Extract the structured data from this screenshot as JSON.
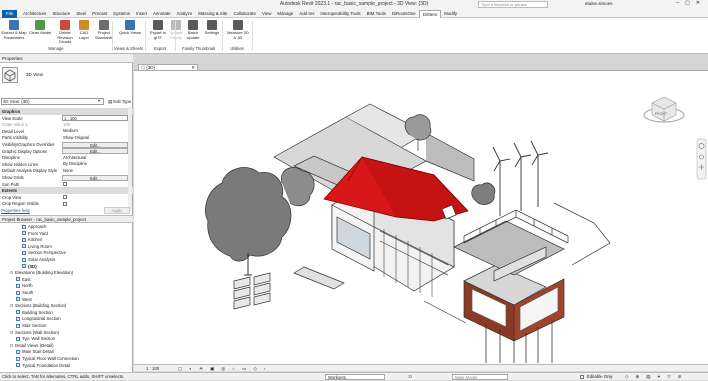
{
  "window": {
    "title": "Autodesk Revit 2023.1 - rac_basic_sample_project - 3D View: {3D}",
    "search_placeholder": "Type a keyword or phrase",
    "user": "elaine.simoes"
  },
  "menu": {
    "file": "File",
    "tabs": [
      "Architecture",
      "Structure",
      "Steel",
      "Precast",
      "Systems",
      "Insert",
      "Annotate",
      "Analyze",
      "Massing & Site",
      "Collaborate",
      "View",
      "Manage",
      "Add-Ins",
      "Interoperability Tools",
      "BIM Tools",
      "DiRootsOne",
      "DiStem",
      "Modify"
    ],
    "active": "DiStem"
  },
  "ribbon": {
    "buttons": [
      {
        "label": "Extract & Map Parameters",
        "color": "#3b74b5"
      },
      {
        "label": "Clean Model",
        "color": "#4a9a4a"
      },
      {
        "label": "Delete Revision Clouds",
        "color": "#c84a3c"
      },
      {
        "label": "CAD Layer",
        "color": "#d08b25"
      },
      {
        "label": "Project Standards",
        "color": "#6d6d6d"
      },
      {
        "label": "Quick Views",
        "color": "#3b74b5"
      },
      {
        "label": "Export to glTF",
        "color": "#5a5a5a"
      },
      {
        "label": "Update Family",
        "color": "#bbbbbb"
      },
      {
        "label": "Batch Update",
        "color": "#5a5a5a"
      },
      {
        "label": "Settings",
        "color": "#5a5a5a"
      },
      {
        "label": "Measure 2D & 3D",
        "color": "#5a5a5a"
      }
    ],
    "groups": [
      "Manage",
      "Views & Sheets",
      "Export",
      "Family Thumbnail",
      "Utilities"
    ]
  },
  "properties": {
    "title": "Properties",
    "type_name": "3D View",
    "selector": "3D View: {3D}",
    "edit_type": "Edit Type",
    "rows": [
      {
        "k": "Graphics",
        "v": "",
        "t": "cat"
      },
      {
        "k": "View Scale",
        "v": "1 : 100",
        "t": "box"
      },
      {
        "k": "Scale Value  1:",
        "v": "100",
        "t": "grey"
      },
      {
        "k": "Detail Level",
        "v": "Medium",
        "t": "text"
      },
      {
        "k": "Parts Visibility",
        "v": "Show Original",
        "t": "text"
      },
      {
        "k": "Visibility/Graphics Overrides",
        "v": "Edit...",
        "t": "btn"
      },
      {
        "k": "Graphic Display Options",
        "v": "Edit...",
        "t": "btn"
      },
      {
        "k": "Discipline",
        "v": "Architectural",
        "t": "text"
      },
      {
        "k": "Show Hidden Lines",
        "v": "By Discipline",
        "t": "text"
      },
      {
        "k": "Default Analysis Display Style",
        "v": "None",
        "t": "text"
      },
      {
        "k": "Show Grids",
        "v": "Edit...",
        "t": "btn"
      },
      {
        "k": "Sun Path",
        "v": "",
        "t": "cb"
      },
      {
        "k": "Extents",
        "v": "",
        "t": "cat"
      },
      {
        "k": "Crop View",
        "v": "",
        "t": "cb"
      },
      {
        "k": "Crop Region Visible",
        "v": "",
        "t": "cb"
      }
    ],
    "help": "Properties help",
    "apply": "Apply"
  },
  "browser": {
    "title": "Project Browser - rac_basic_sample_project",
    "items": [
      {
        "label": "Approach",
        "lvl": 3,
        "vi": true
      },
      {
        "label": "From Yard",
        "lvl": 3,
        "vi": true
      },
      {
        "label": "Kitchen",
        "lvl": 3,
        "vi": true
      },
      {
        "label": "Living Room",
        "lvl": 3,
        "vi": true
      },
      {
        "label": "Section Perspective",
        "lvl": 3,
        "vi": true
      },
      {
        "label": "Solar Analysis",
        "lvl": 3,
        "vi": true
      },
      {
        "label": "{3D}",
        "lvl": 3,
        "vi": true,
        "bold": true
      },
      {
        "label": "Elevations (Building Elevation)",
        "lvl": 1,
        "ex": "⊟"
      },
      {
        "label": "East",
        "lvl": 2,
        "vi": true
      },
      {
        "label": "North",
        "lvl": 2,
        "vi": true
      },
      {
        "label": "South",
        "lvl": 2,
        "vi": true
      },
      {
        "label": "West",
        "lvl": 2,
        "vi": true
      },
      {
        "label": "Sections (Building Section)",
        "lvl": 1,
        "ex": "⊟"
      },
      {
        "label": "Building Section",
        "lvl": 2,
        "vi": true
      },
      {
        "label": "Longitudinal Section",
        "lvl": 2,
        "vi": true
      },
      {
        "label": "Stair Section",
        "lvl": 2,
        "vi": true
      },
      {
        "label": "Sections (Wall Section)",
        "lvl": 1,
        "ex": "⊟"
      },
      {
        "label": "Typ. Wall Section",
        "lvl": 2,
        "vi": true
      },
      {
        "label": "Detail Views (Detail)",
        "lvl": 1,
        "ex": "⊟"
      },
      {
        "label": "Main Stair Detail",
        "lvl": 2,
        "vi": true
      },
      {
        "label": "Typical Floor Wall Connection",
        "lvl": 2,
        "vi": true
      },
      {
        "label": "Typical Foundation Detail",
        "lvl": 2,
        "vi": true
      }
    ]
  },
  "view": {
    "tab": "{3D}",
    "scale": "1 : 100",
    "viewcube_face": "FRONT"
  },
  "status": {
    "hint": "Click to select, TAB for alternates, CTRL adds, SHIFT unselects.",
    "workset": "Workset1",
    "editable_only": "Editable Only",
    "model": "Main Model",
    "filter_count": ":0"
  }
}
